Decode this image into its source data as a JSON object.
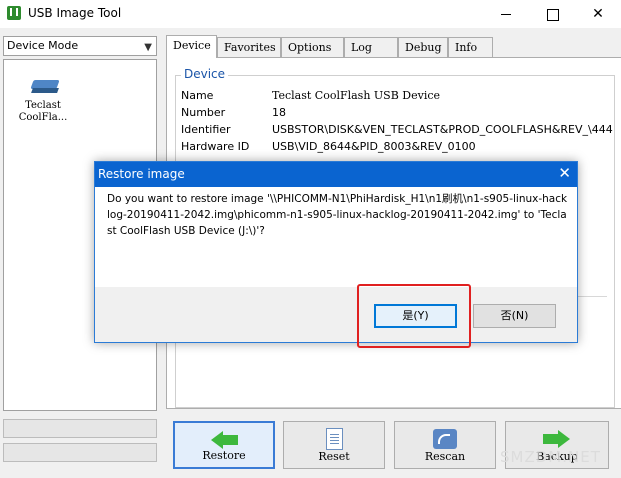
{
  "window": {
    "title": "USB Image Tool",
    "minimize": "—",
    "maximize": "☐",
    "close": "✕"
  },
  "sidebar": {
    "mode": "Device Mode",
    "devices": [
      {
        "label": "Teclast\nCoolFla..."
      }
    ]
  },
  "tabs": [
    "Device",
    "Favorites",
    "Options",
    "Log",
    "Debug",
    "Info"
  ],
  "device_info": {
    "group_title": "Device",
    "rows": [
      {
        "key": "Name",
        "value": "Teclast CoolFlash USB Device"
      },
      {
        "key": "Number",
        "value": "18"
      },
      {
        "key": "Identifier",
        "value": "USBSTOR\\DISK&VEN_TECLAST&PROD_COOLFLASH&REV_\\444"
      },
      {
        "key": "Hardware ID",
        "value": "USB\\VID_8644&PID_8003&REV_0100"
      }
    ]
  },
  "buttons": {
    "restore": "Restore",
    "reset": "Reset",
    "rescan": "Rescan",
    "backup": "Backup"
  },
  "dialog": {
    "title": "Restore image",
    "close": "✕",
    "message": "Do you want to restore image '\\\\PHICOMM-N1\\PhiHardisk_H1\\n1刷机\\n1-s905-linux-hacklog-20190411-2042.img\\phicomm-n1-s905-linux-hacklog-20190411-2042.img' to 'Teclast CoolFlash USB Device (J:\\)'?",
    "yes": "是(Y)",
    "no": "否(N)"
  },
  "watermark": "SMZDM.NET",
  "colors": {
    "titlebar_active": "#0a64d0",
    "accent_border": "#0078d7",
    "highlight": "#e02020",
    "group_title": "#1a54a8"
  }
}
